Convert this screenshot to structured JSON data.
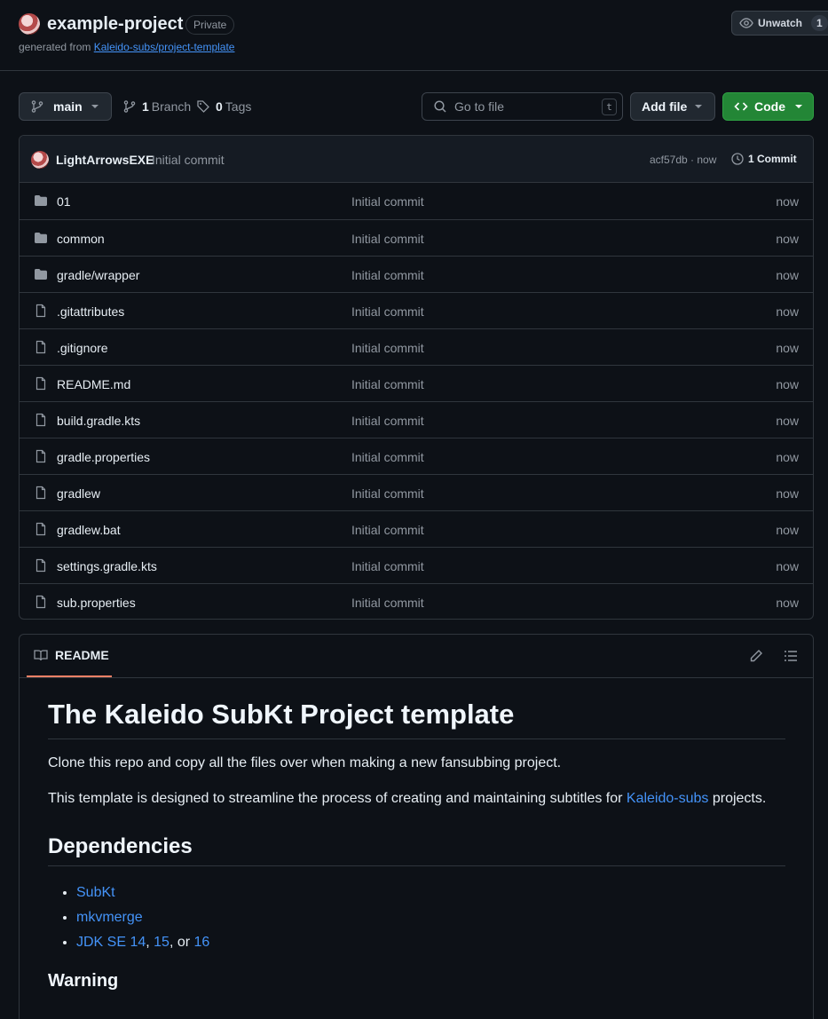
{
  "repo": {
    "name": "example-project",
    "visibility": "Private",
    "generated_prefix": "generated from ",
    "template_link": "Kaleido-subs/project-template"
  },
  "watch": {
    "label": "Unwatch",
    "count": "1"
  },
  "toolbar": {
    "branch": "main",
    "branch_count": "1",
    "branch_label": "Branch",
    "tag_count": "0",
    "tag_label": "Tags",
    "search_placeholder": "Go to file",
    "search_key": "t",
    "add_file": "Add file",
    "code": "Code"
  },
  "latest_commit": {
    "author": "LightArrowsEXE",
    "message": "Initial commit",
    "hash_time": "acf57db · now",
    "commit_count": "1 Commit"
  },
  "files": [
    {
      "name": "01",
      "type": "folder",
      "commit": "Initial commit",
      "time": "now"
    },
    {
      "name": "common",
      "type": "folder",
      "commit": "Initial commit",
      "time": "now"
    },
    {
      "name": "gradle/wrapper",
      "type": "folder",
      "commit": "Initial commit",
      "time": "now"
    },
    {
      "name": ".gitattributes",
      "type": "file",
      "commit": "Initial commit",
      "time": "now"
    },
    {
      "name": ".gitignore",
      "type": "file",
      "commit": "Initial commit",
      "time": "now"
    },
    {
      "name": "README.md",
      "type": "file",
      "commit": "Initial commit",
      "time": "now"
    },
    {
      "name": "build.gradle.kts",
      "type": "file",
      "commit": "Initial commit",
      "time": "now"
    },
    {
      "name": "gradle.properties",
      "type": "file",
      "commit": "Initial commit",
      "time": "now"
    },
    {
      "name": "gradlew",
      "type": "file",
      "commit": "Initial commit",
      "time": "now"
    },
    {
      "name": "gradlew.bat",
      "type": "file",
      "commit": "Initial commit",
      "time": "now"
    },
    {
      "name": "settings.gradle.kts",
      "type": "file",
      "commit": "Initial commit",
      "time": "now"
    },
    {
      "name": "sub.properties",
      "type": "file",
      "commit": "Initial commit",
      "time": "now"
    }
  ],
  "readme": {
    "tab": "README",
    "title": "The Kaleido SubKt Project template",
    "p1": "Clone this repo and copy all the files over when making a new fansubbing project.",
    "p2_pre": "This template is designed to streamline the process of creating and maintaining subtitles for ",
    "p2_link": "Kaleido-subs",
    "p2_post": " projects.",
    "deps_heading": "Dependencies",
    "dep1": "SubKt",
    "dep2": "mkvmerge",
    "dep3_link1": "JDK SE 14",
    "dep3_sep1": ", ",
    "dep3_link2": "15",
    "dep3_sep2": ", or ",
    "dep3_link3": "16",
    "warning_heading": "Warning"
  },
  "colors": {
    "accent_link": "#4493f8",
    "code_button": "#238636",
    "tab_underline": "#f78166",
    "background": "#0d1117"
  }
}
